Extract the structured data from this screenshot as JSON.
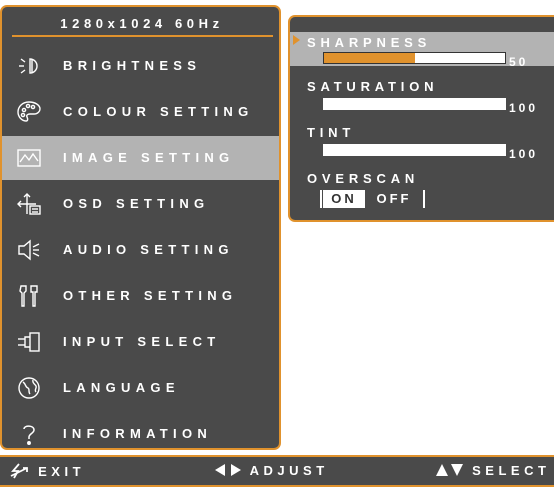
{
  "resolution": "1280x1024 60Hz",
  "menu": {
    "items": [
      {
        "label": "BRIGHTNESS",
        "icon": "brightness-icon"
      },
      {
        "label": "COLOUR SETTING",
        "icon": "palette-icon"
      },
      {
        "label": "IMAGE SETTING",
        "icon": "image-icon",
        "selected": true
      },
      {
        "label": "OSD SETTING",
        "icon": "osd-icon"
      },
      {
        "label": "AUDIO SETTING",
        "icon": "speaker-icon"
      },
      {
        "label": "OTHER SETTING",
        "icon": "tools-icon"
      },
      {
        "label": "INPUT SELECT",
        "icon": "input-plug-icon"
      },
      {
        "label": "LANGUAGE",
        "icon": "globe-icon"
      },
      {
        "label": "INFORMATION",
        "icon": "question-icon"
      }
    ]
  },
  "image_settings": {
    "sharpness": {
      "label": "SHARPNESS",
      "value": "50",
      "level": 0.5
    },
    "saturation": {
      "label": "SATURATION",
      "value": "100",
      "level": 1.0
    },
    "tint": {
      "label": "TINT",
      "value": "100",
      "level": 1.0
    },
    "overscan": {
      "label": "OVERSCAN",
      "on_label": "ON",
      "off_label": "OFF",
      "selected": "ON"
    }
  },
  "footer": {
    "exit": "EXIT",
    "adjust": "ADJUST",
    "select": "SELECT"
  },
  "colors": {
    "accent": "#e0922d",
    "panel": "#4a4a4a",
    "selected": "#b3b3b3"
  }
}
